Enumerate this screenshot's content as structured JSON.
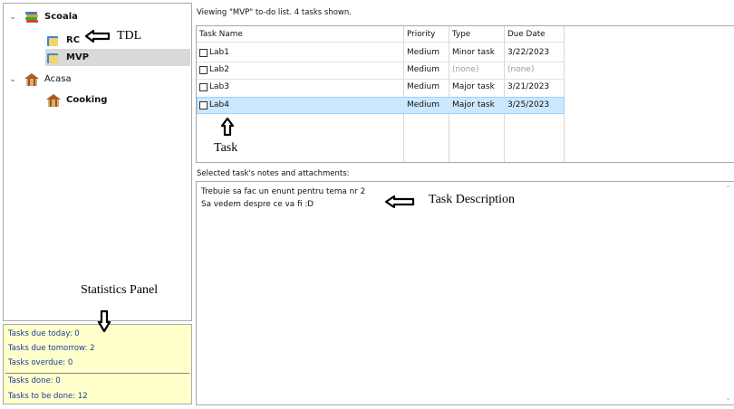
{
  "tree": {
    "items": [
      {
        "label": "Scoala",
        "chevron": "⌄",
        "icon": "books-icon"
      },
      {
        "label": "RC",
        "icon": "book-folder-icon"
      },
      {
        "label": "MVP",
        "icon": "book-folder-icon"
      },
      {
        "label": "Acasa",
        "chevron": "⌄",
        "icon": "building-icon"
      },
      {
        "label": "Cooking",
        "icon": "building-icon"
      }
    ]
  },
  "stats": {
    "due_today": "Tasks due today: 0",
    "due_tomorrow": "Tasks due tomorrow: 2",
    "overdue": "Tasks overdue: 0",
    "done": "Tasks done: 0",
    "to_be_done": "Tasks to be done: 12"
  },
  "viewing_text": "Viewing \"MVP\" to-do list. 4 tasks shown.",
  "table": {
    "columns": [
      "Task Name",
      "Priority",
      "Type",
      "Due Date"
    ],
    "rows": [
      {
        "name": "Lab1",
        "priority": "Medium",
        "type": "Minor task",
        "due": "3/22/2023"
      },
      {
        "name": "Lab2",
        "priority": "Medium",
        "type": "(none)",
        "due": "(none)"
      },
      {
        "name": "Lab3",
        "priority": "Medium",
        "type": "Major task",
        "due": "3/21/2023"
      },
      {
        "name": "Lab4",
        "priority": "Medium",
        "type": "Major task",
        "due": "3/25/2023"
      }
    ]
  },
  "notes": {
    "label": "Selected task's notes and attachments:",
    "lines": [
      "Trebuie sa fac un enunt pentru tema nr 2",
      "Sa vedem despre ce va fi :D"
    ]
  },
  "annotations": {
    "tdl": "TDL",
    "task": "Task",
    "task_description": "Task Description",
    "statistics_panel": "Statistics Panel"
  },
  "colors": {
    "stats_bg": "#ffffcc",
    "stats_text": "#1a3c9a",
    "selected_row": "#cce8ff",
    "selected_tree": "#d9d9d9"
  }
}
